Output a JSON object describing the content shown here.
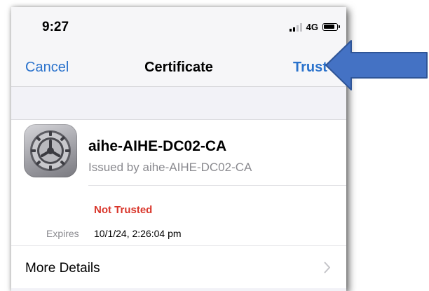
{
  "status_bar": {
    "time": "9:27",
    "network": "4G",
    "signal_bars": 4,
    "signal_active": 2
  },
  "nav": {
    "cancel_label": "Cancel",
    "title": "Certificate",
    "trust_label": "Trust"
  },
  "certificate": {
    "name": "aihe-AIHE-DC02-CA",
    "issuer": "Issued by aihe-AIHE-DC02-CA",
    "status": "Not Trusted",
    "expires_label": "Expires",
    "expires_value": "10/1/24, 2:26:04 pm",
    "icon": "settings-gear-icon"
  },
  "more_details": {
    "label": "More Details",
    "icon": "chevron-right-icon"
  },
  "annotation": {
    "icon": "arrow-left-icon",
    "color": "#4472c4"
  },
  "colors": {
    "accent": "#2a72cc",
    "danger": "#d9362b",
    "secondary_text": "#8a8a8f",
    "grouped_background": "#f2f2f7"
  }
}
